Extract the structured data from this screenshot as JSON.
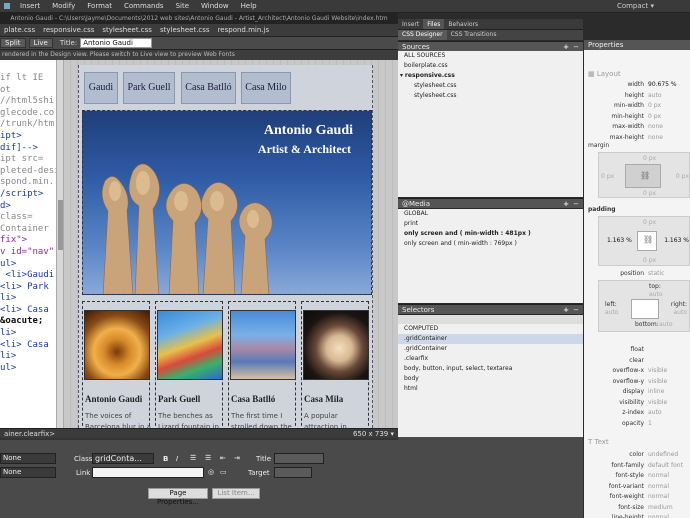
{
  "menu": {
    "items": [
      "Insert",
      "Modify",
      "Format",
      "Commands",
      "Site",
      "Window",
      "Help"
    ],
    "workspace": "Compact ▾"
  },
  "window_title": "Antonio Gaudi - C:\\Users\\Jayme\\Documents\\2012 web sites\\Antonio Gaudi - Artist_Architect\\Antonio Gaudi Website\\index.htm",
  "file_tabs": [
    "plate.css",
    "responsive.css",
    "stylesheet.css",
    "stylesheet.css",
    "respond.min.js"
  ],
  "toolbar": {
    "split_label": "Split",
    "live_label": "Live",
    "title_label": "Title:",
    "title_value": "Antonio Gaudi Architect"
  },
  "notice_text": "rendered in the Design view. Please switch to Live view to preview Web Fonts",
  "code_lines": [
    "if lt IE",
    "",
    "ot",
    "//html5shi",
    "glecode.co",
    "/trunk/htm",
    "",
    "ipt>",
    "dif]-->",
    "ipt src=",
    "pleted-desi",
    "spond.min.",
    "/script>",
    "d>",
    "",
    "class=",
    "Container",
    "fix\">",
    "v id=\"nav\"",
    "",
    "ul>",
    " <li>Gaudi",
    "",
    "<li> Park",
    "li>",
    "<li> Casa",
    "&oacute;",
    "li>",
    "<li> Casa",
    "li>",
    "ul>"
  ],
  "nav_buttons": [
    "Gaudi",
    "Park Guell",
    "Casa Batlló",
    "Casa Milo"
  ],
  "hero": {
    "title_line1": "Antonio Gaudi",
    "title_line2": "Artist & Architect"
  },
  "cards": [
    {
      "title": "Antonio Gaudi",
      "text": "The voices of Barcelona blur in a mix"
    },
    {
      "title": "Park Guell",
      "text": "The benches as Lizard fountain in Park Guell"
    },
    {
      "title": "Casa Batlló",
      "text": "The first time I strolled down the Passeig de"
    },
    {
      "title": "Casa Mila",
      "text": "A popular attraction in Barcelona, Casa Mila"
    }
  ],
  "status": {
    "tag": "ainer.clearfix>",
    "size": "650 x 739 ▾"
  },
  "properties": {
    "format_value": "None",
    "id_value": "None",
    "class_label": "Class",
    "class_value": "gridConta...",
    "link_label": "Link",
    "title_label": "Title",
    "target_label": "Target",
    "page_props_label": "Page Properties...",
    "list_item_label": "List Item..."
  },
  "right_tabs": [
    "Insert",
    "Files",
    "Behaviors"
  ],
  "right_subtabs": [
    "CSS Designer",
    "CSS Transitions"
  ],
  "sources": {
    "header": "Sources",
    "items": [
      "ALL SOURCES",
      "boilerplate.css",
      "responsive.css",
      "stylesheet.css",
      "stylesheet.css"
    ]
  },
  "media": {
    "header": "@Media",
    "items": [
      "GLOBAL",
      "print",
      "only screen and ( min-width : 481px )",
      "only screen and ( min-width : 769px )"
    ]
  },
  "selectors": {
    "header": "Selectors",
    "items": [
      "COMPUTED",
      ".gridContainer",
      ".gridContainer",
      ".clearfix",
      "body, button, input, select, textarea",
      "body",
      "html"
    ]
  },
  "props_panel": {
    "header": "Properties",
    "layout_label": "Layout",
    "layout_rows": [
      {
        "k": "width",
        "v": "90.675 %"
      },
      {
        "k": "height",
        "v": "auto"
      },
      {
        "k": "min-width",
        "v": "0 px"
      },
      {
        "k": "min-height",
        "v": "0 px"
      },
      {
        "k": "max-width",
        "v": "none"
      },
      {
        "k": "max-height",
        "v": "none"
      }
    ],
    "margin_label": "margin",
    "margin_top": "0 px",
    "margin_left": "0 px",
    "margin_right": "0 px",
    "margin_bottom": "0 px",
    "padding_label": "padding",
    "padding_top": "0 px",
    "padding_left": "1.163 %",
    "padding_right": "1.163 %",
    "padding_bottom": "0 px",
    "position_rows": [
      {
        "k": "position",
        "v": "static"
      }
    ],
    "top_label": "top:",
    "top_value": "auto",
    "left_label": "left:",
    "left_value": "auto",
    "right_label": "right:",
    "right_value": "auto",
    "bottom_label": "bottom:",
    "bottom_value": "auto",
    "misc_rows": [
      {
        "k": "float",
        "v": ""
      },
      {
        "k": "clear",
        "v": ""
      },
      {
        "k": "overflow-x",
        "v": "visible"
      },
      {
        "k": "overflow-y",
        "v": "visible"
      },
      {
        "k": "display",
        "v": "inline"
      },
      {
        "k": "visibility",
        "v": "visible"
      },
      {
        "k": "z-index",
        "v": "auto"
      },
      {
        "k": "opacity",
        "v": "1"
      }
    ],
    "text_label": "Text",
    "text_rows": [
      {
        "k": "color",
        "v": "undefined"
      },
      {
        "k": "font-family",
        "v": "default font"
      },
      {
        "k": "font-style",
        "v": "normal"
      },
      {
        "k": "font-variant",
        "v": "normal"
      },
      {
        "k": "font-weight",
        "v": "normal"
      },
      {
        "k": "font-size",
        "v": "medium"
      },
      {
        "k": "line-height",
        "v": "normal"
      }
    ]
  }
}
